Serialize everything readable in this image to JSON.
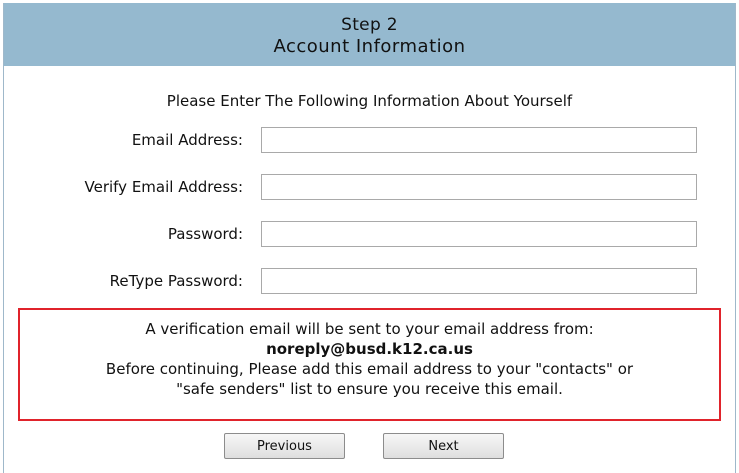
{
  "header": {
    "step": "Step 2",
    "title": "Account Information"
  },
  "intro": "Please Enter The Following Information About Yourself",
  "fields": {
    "email": {
      "label": "Email Address:",
      "value": ""
    },
    "verify_email": {
      "label": "Verify Email Address:",
      "value": ""
    },
    "password": {
      "label": "Password:",
      "value": ""
    },
    "retype_password": {
      "label": "ReType Password:",
      "value": ""
    }
  },
  "notice": {
    "line1": "A verification email will be sent to your email address from:",
    "email": "noreply@busd.k12.ca.us",
    "line3": "Before continuing, Please add this email address to your \"contacts\" or",
    "line4": "\"safe senders\" list to ensure you receive this email.",
    "border_color": "#e0232b"
  },
  "buttons": {
    "previous": "Previous",
    "next": "Next"
  },
  "colors": {
    "header_bg": "#95b9cf"
  }
}
